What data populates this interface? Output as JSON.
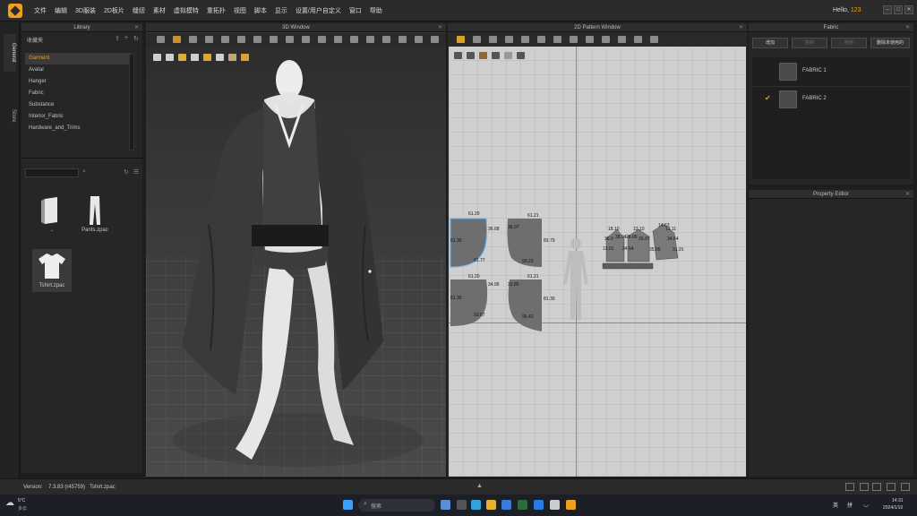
{
  "app": {
    "greeting_prefix": "Hello,",
    "user": "123"
  },
  "menu": [
    "文件",
    "编辑",
    "3D服装",
    "2D板片",
    "缝纫",
    "素材",
    "虚拟模特",
    "重拓扑",
    "视图",
    "脚本",
    "显示",
    "设置/用户自定义",
    "窗口",
    "帮助"
  ],
  "side_tabs": [
    "General",
    "Store"
  ],
  "library": {
    "title": "Library",
    "favorites_label": "收藏夹",
    "items": [
      "Garment",
      "Avatar",
      "Hanger",
      "Fabric",
      "Substance",
      "Interior_Fabric",
      "Hardware_and_Trims"
    ],
    "selected": "Garment",
    "thumbnails": [
      {
        "name": "..",
        "icon": "folder-icon"
      },
      {
        "name": "Pants.zpac",
        "icon": "pants-icon"
      },
      {
        "name": "Tshirt.zpac",
        "icon": "tshirt-icon"
      }
    ]
  },
  "win3d": {
    "title": "3D Window"
  },
  "win2d": {
    "title": "2D Pattern Window",
    "labels": {
      "p1_top": "61.20",
      "p1_right": "36.68",
      "p1_left": "81.30",
      "p1_bottom": "91.77",
      "p2_top": "61.21",
      "p2_left": "36.97",
      "p2_right": "83.79",
      "p2_bottom": "93.23",
      "p3_top": "61.20",
      "p3_right": "34.06",
      "p3_left": "81.30",
      "p3_bottom": "93.67",
      "p4_top": "61.21",
      "p4_left": "33.85",
      "p4_right": "81.30",
      "p4_bottom": "95.43",
      "s1": "18.10",
      "s2": "13.10",
      "s3": "14.63",
      "s4": "13.11",
      "s5": "36.9",
      "s6": "38.04",
      "s7": "28.06",
      "s8": "26.97",
      "s9": "34.64",
      "s10": "13.01",
      "s11": "34.64",
      "s12": "35.95",
      "s13": "31.91"
    }
  },
  "fabric": {
    "title": "Fabric",
    "buttons": [
      {
        "label": "增加",
        "enabled": true
      },
      {
        "label": "复制",
        "enabled": false
      },
      {
        "label": "删除",
        "enabled": false
      },
      {
        "label": "删除未使用的",
        "enabled": true
      }
    ],
    "items": [
      {
        "name": "FABRIC 1",
        "checked": false
      },
      {
        "name": "FABRIC 2",
        "checked": true
      }
    ]
  },
  "property_editor": {
    "title": "Property Editor"
  },
  "status": {
    "version_label": "Version:",
    "version": "7.3.83 (r45759)",
    "file": "Tshirt.zpac"
  },
  "taskbar": {
    "weather_temp": "5°C",
    "weather_desc": "多云",
    "search_placeholder": "搜索",
    "ime1": "英",
    "ime2": "拼",
    "time": "14:31",
    "date": "2024/1/10"
  }
}
